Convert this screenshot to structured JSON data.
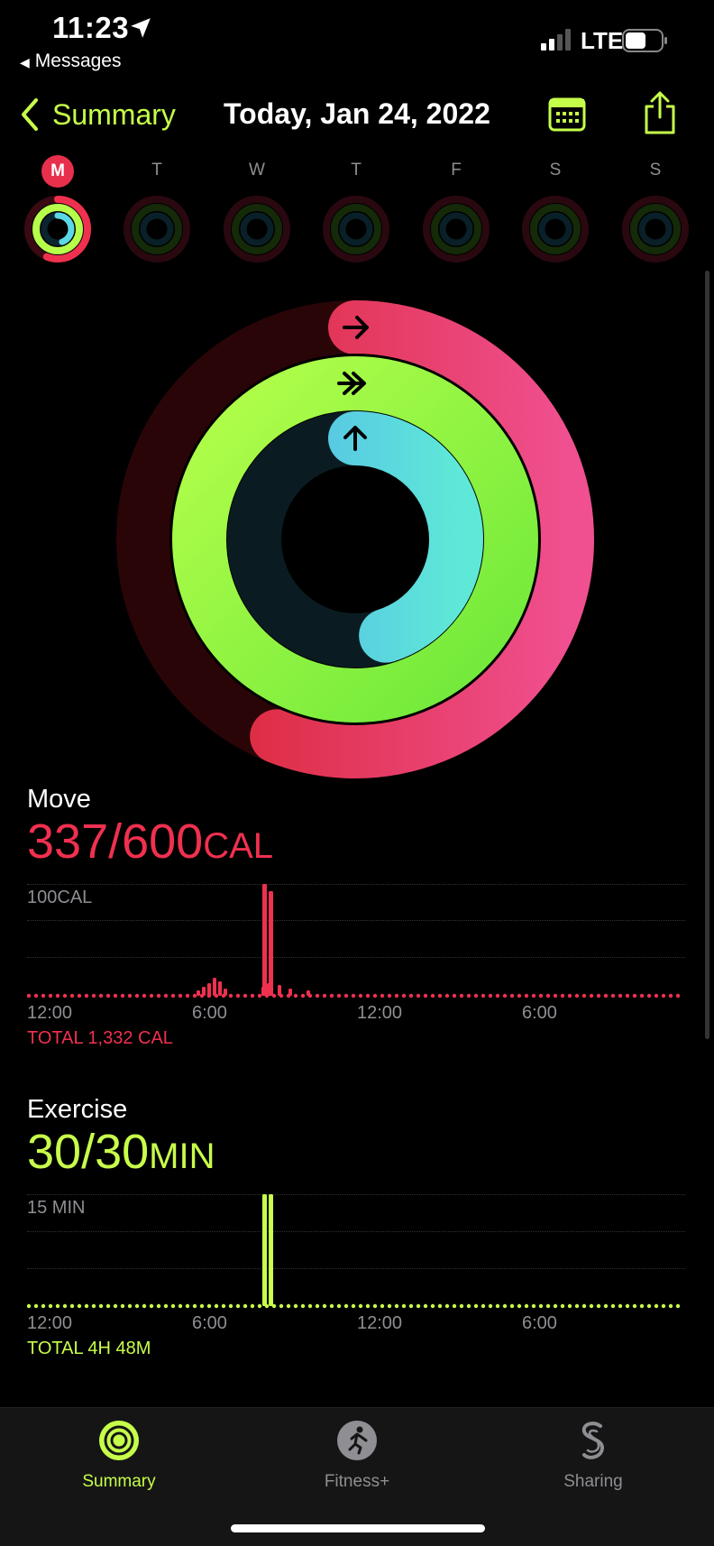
{
  "status": {
    "time": "11:23",
    "back_app": "Messages",
    "network": "LTE"
  },
  "nav": {
    "back_label": "Summary",
    "title": "Today, Jan 24, 2022"
  },
  "week": [
    {
      "letter": "M",
      "active": true
    },
    {
      "letter": "T",
      "active": false
    },
    {
      "letter": "W",
      "active": false
    },
    {
      "letter": "T",
      "active": false
    },
    {
      "letter": "F",
      "active": false
    },
    {
      "letter": "S",
      "active": false
    },
    {
      "letter": "S",
      "active": false
    }
  ],
  "rings": {
    "move_progress": 0.56,
    "exercise_progress": 1.0,
    "stand_progress": 0.45
  },
  "move": {
    "label": "Move",
    "value": "337/600",
    "unit": "CAL",
    "axis_top": "100CAL",
    "x_labels": [
      "12:00",
      "6:00",
      "12:00",
      "6:00"
    ],
    "total": "TOTAL 1,332 CAL"
  },
  "exercise": {
    "label": "Exercise",
    "value": "30/30",
    "unit": "MIN",
    "axis_top": "15 MIN",
    "x_labels": [
      "12:00",
      "6:00",
      "12:00",
      "6:00"
    ],
    "total": "TOTAL 4H 48M"
  },
  "tabs": [
    {
      "label": "Summary",
      "icon": "activity-rings-icon",
      "active": true
    },
    {
      "label": "Fitness+",
      "icon": "running-figure-icon",
      "active": false
    },
    {
      "label": "Sharing",
      "icon": "sharing-icon",
      "active": false
    }
  ],
  "colors": {
    "move": "#f0304f",
    "exercise": "#c8ff4a",
    "stand": "#5ad8e6",
    "accent": "#c6ff4a"
  }
}
